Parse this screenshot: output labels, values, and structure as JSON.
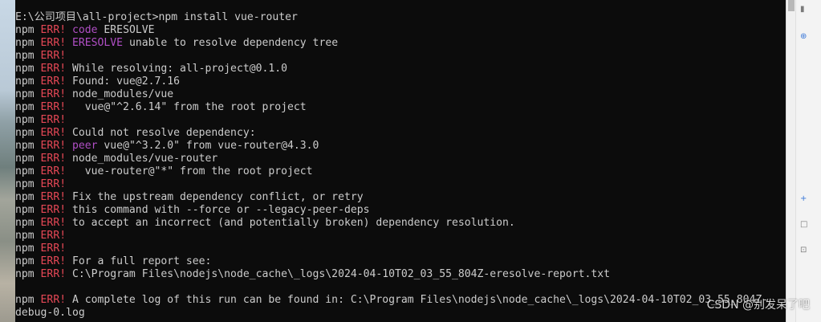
{
  "console": {
    "lines": [
      [
        {
          "t": "E:\\公司项目\\all-project>npm install vue-router",
          "c": "msg"
        }
      ],
      [
        {
          "t": "npm ",
          "c": "npm"
        },
        {
          "t": "ERR!",
          "c": "err"
        },
        {
          "t": " ",
          "c": "msg"
        },
        {
          "t": "code",
          "c": "kw"
        },
        {
          "t": " ERESOLVE",
          "c": "msg"
        }
      ],
      [
        {
          "t": "npm ",
          "c": "npm"
        },
        {
          "t": "ERR!",
          "c": "err"
        },
        {
          "t": " ",
          "c": "msg"
        },
        {
          "t": "ERESOLVE",
          "c": "kw"
        },
        {
          "t": " unable to resolve dependency tree",
          "c": "msg"
        }
      ],
      [
        {
          "t": "npm ",
          "c": "npm"
        },
        {
          "t": "ERR!",
          "c": "err"
        }
      ],
      [
        {
          "t": "npm ",
          "c": "npm"
        },
        {
          "t": "ERR!",
          "c": "err"
        },
        {
          "t": " While resolving: all-project@0.1.0",
          "c": "msg"
        }
      ],
      [
        {
          "t": "npm ",
          "c": "npm"
        },
        {
          "t": "ERR!",
          "c": "err"
        },
        {
          "t": " Found: vue@2.7.16",
          "c": "msg"
        }
      ],
      [
        {
          "t": "npm ",
          "c": "npm"
        },
        {
          "t": "ERR!",
          "c": "err"
        },
        {
          "t": " node_modules/vue",
          "c": "msg"
        }
      ],
      [
        {
          "t": "npm ",
          "c": "npm"
        },
        {
          "t": "ERR!",
          "c": "err"
        },
        {
          "t": "   vue@\"^2.6.14\" from the root project",
          "c": "msg"
        }
      ],
      [
        {
          "t": "npm ",
          "c": "npm"
        },
        {
          "t": "ERR!",
          "c": "err"
        }
      ],
      [
        {
          "t": "npm ",
          "c": "npm"
        },
        {
          "t": "ERR!",
          "c": "err"
        },
        {
          "t": " Could not resolve dependency:",
          "c": "msg"
        }
      ],
      [
        {
          "t": "npm ",
          "c": "npm"
        },
        {
          "t": "ERR!",
          "c": "err"
        },
        {
          "t": " ",
          "c": "msg"
        },
        {
          "t": "peer",
          "c": "kw"
        },
        {
          "t": " vue@\"^3.2.0\" from vue-router@4.3.0",
          "c": "msg"
        }
      ],
      [
        {
          "t": "npm ",
          "c": "npm"
        },
        {
          "t": "ERR!",
          "c": "err"
        },
        {
          "t": " node_modules/vue-router",
          "c": "msg"
        }
      ],
      [
        {
          "t": "npm ",
          "c": "npm"
        },
        {
          "t": "ERR!",
          "c": "err"
        },
        {
          "t": "   vue-router@\"*\" from the root project",
          "c": "msg"
        }
      ],
      [
        {
          "t": "npm ",
          "c": "npm"
        },
        {
          "t": "ERR!",
          "c": "err"
        }
      ],
      [
        {
          "t": "npm ",
          "c": "npm"
        },
        {
          "t": "ERR!",
          "c": "err"
        },
        {
          "t": " Fix the upstream dependency conflict, or retry",
          "c": "msg"
        }
      ],
      [
        {
          "t": "npm ",
          "c": "npm"
        },
        {
          "t": "ERR!",
          "c": "err"
        },
        {
          "t": " this command with --force or --legacy-peer-deps",
          "c": "msg"
        }
      ],
      [
        {
          "t": "npm ",
          "c": "npm"
        },
        {
          "t": "ERR!",
          "c": "err"
        },
        {
          "t": " to accept an incorrect (and potentially broken) dependency resolution.",
          "c": "msg"
        }
      ],
      [
        {
          "t": "npm ",
          "c": "npm"
        },
        {
          "t": "ERR!",
          "c": "err"
        }
      ],
      [
        {
          "t": "npm ",
          "c": "npm"
        },
        {
          "t": "ERR!",
          "c": "err"
        }
      ],
      [
        {
          "t": "npm ",
          "c": "npm"
        },
        {
          "t": "ERR!",
          "c": "err"
        },
        {
          "t": " For a full report see:",
          "c": "msg"
        }
      ],
      [
        {
          "t": "npm ",
          "c": "npm"
        },
        {
          "t": "ERR!",
          "c": "err"
        },
        {
          "t": " C:\\Program Files\\nodejs\\node_cache\\_logs\\2024-04-10T02_03_55_804Z-eresolve-report.txt",
          "c": "msg"
        }
      ],
      [],
      [
        {
          "t": "npm ",
          "c": "npm"
        },
        {
          "t": "ERR!",
          "c": "err"
        },
        {
          "t": " A complete log of this run can be found in: C:\\Program Files\\nodejs\\node_cache\\_logs\\2024-04-10T02_03_55_804Z-",
          "c": "msg"
        }
      ],
      [
        {
          "t": "debug-0.log",
          "c": "msg"
        }
      ]
    ]
  },
  "watermark": {
    "text": "CSDN @别发呆了吧"
  },
  "right_strip": {
    "marks": [
      "▮",
      "⊕",
      "+",
      "□",
      "⊡"
    ]
  },
  "colors": {
    "console_bg": "#0c0c0c",
    "text": "#cccccc",
    "err_red": "#e74856",
    "keyword_magenta": "#b14fc6"
  }
}
